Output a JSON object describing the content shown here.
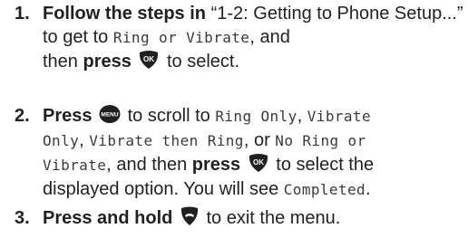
{
  "steps": [
    {
      "number": "1.",
      "bold_lead": "Follow the steps in",
      "quote": "“1-2: Getting to Phone Setup...”",
      "text_a": "to get to",
      "lcd_a": "Ring or Vibrate",
      "text_b": ", and",
      "text_c": "then",
      "bold_press": "press",
      "key_icon": "ok-key-icon",
      "text_d": "to select."
    },
    {
      "number": "2.",
      "bold_press": "Press",
      "key_icon": "menu-key-icon",
      "text_a": "to scroll to",
      "lcd_a": "Ring Only",
      "sep_a": ",",
      "lcd_b": "Vibrate",
      "lcd_c": "Only",
      "sep_b": ",",
      "lcd_d": "Vibrate then Ring",
      "sep_c": ", or",
      "lcd_e": "No Ring or",
      "lcd_f": "Vibrate",
      "text_b": ", and then",
      "bold_press2": "press",
      "key_icon2": "ok-key-icon",
      "text_c": "to select the",
      "text_d": "displayed option. You will see",
      "lcd_g": "Completed",
      "text_e": "."
    },
    {
      "number": "3.",
      "bold_lead": "Press and hold",
      "key_icon": "end-key-icon",
      "text_a": "to exit the menu."
    }
  ],
  "icons": {
    "ok_key": "OK",
    "menu_key": "MENU"
  },
  "colors": {
    "text": "#231f20",
    "icon": "#231f20"
  }
}
